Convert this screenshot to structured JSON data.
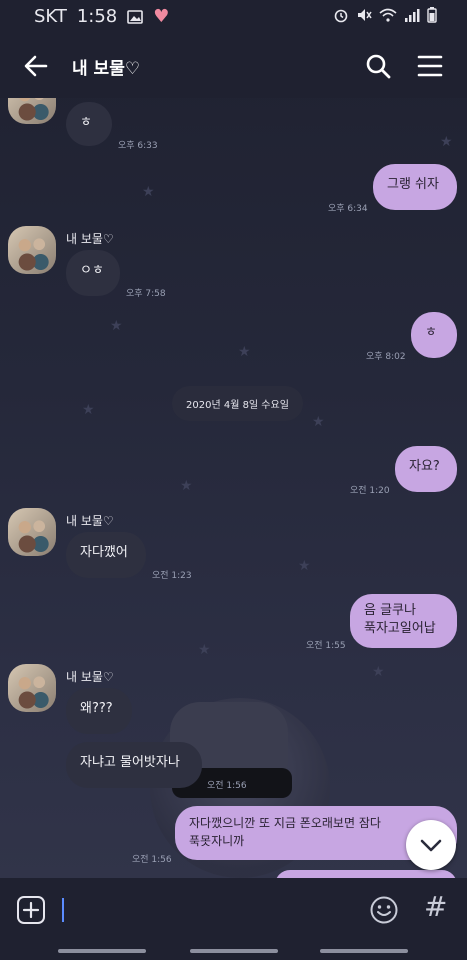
{
  "status_bar": {
    "carrier": "SKT",
    "time": "1:58"
  },
  "header": {
    "title": "내 보물♡"
  },
  "messages": {
    "m1": {
      "text": "ㅎ",
      "time": "오후 6:33"
    },
    "m2": {
      "text": "그랭 쉬자",
      "time": "오후 6:34"
    },
    "sender2": "내 보물♡",
    "m3": {
      "text": "ㅇㅎ",
      "time": "오후 7:58"
    },
    "m4": {
      "text": "ㅎ",
      "time": "오후 8:02"
    },
    "date_divider": "2020년 4월 8일 수요일",
    "m5": {
      "text": "자요?",
      "time": "오전 1:20"
    },
    "sender3": "내 보물♡",
    "m6": {
      "text": "자다깼어",
      "time": "오전 1:23"
    },
    "m7": {
      "text": "음 글쿠나\n푹자고일어납",
      "time": "오전 1:55"
    },
    "sender4": "내 보물♡",
    "m8": {
      "text": "왜???",
      "time": ""
    },
    "m9": {
      "text": "자냐고 물어밧자나",
      "time": "오전 1:56"
    },
    "m10": {
      "text": "자다깼으니깐 또 지금 폰오래보면 잠다\n푹못자니까",
      "time": "오전 1:56"
    }
  },
  "colors": {
    "incoming_bubble": "#2e3040",
    "outgoing_bubble": "#c7a6e2",
    "bar": "#1f2130"
  }
}
